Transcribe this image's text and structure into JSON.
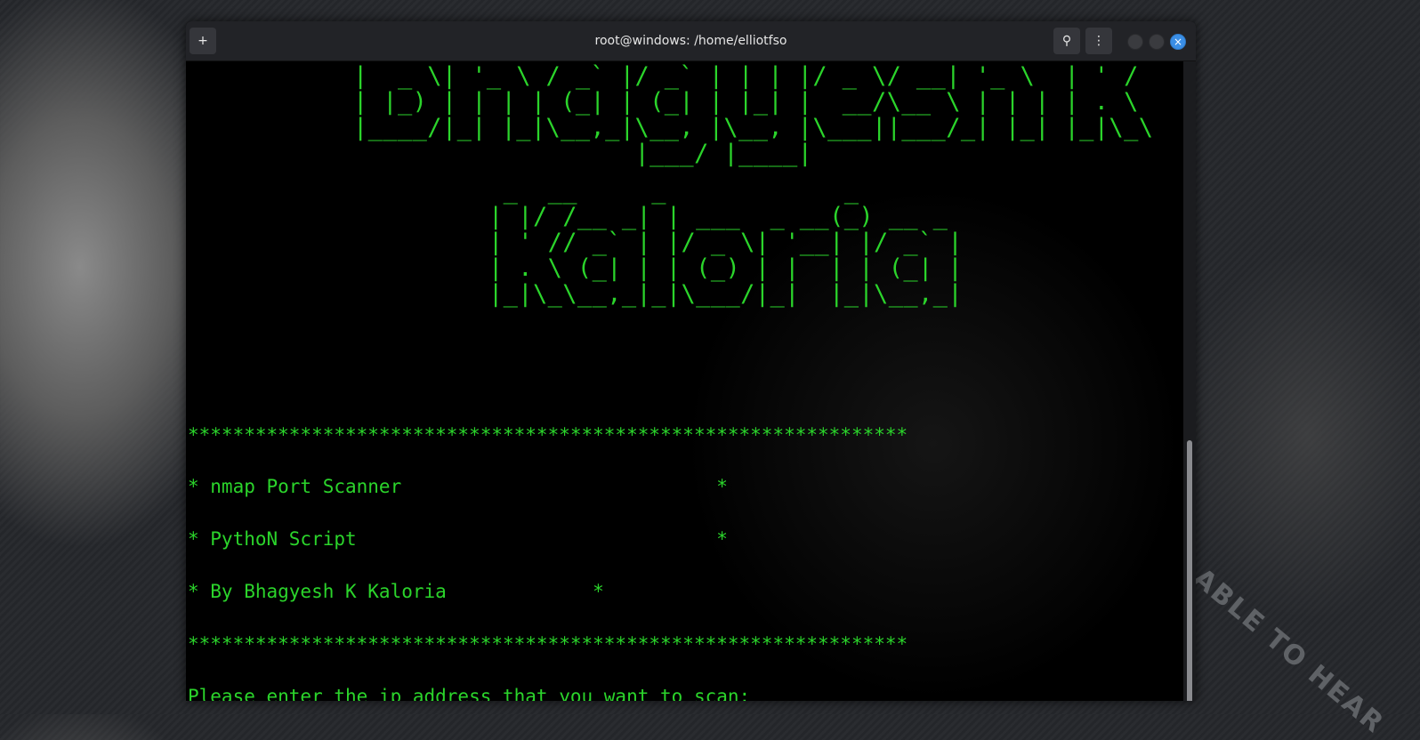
{
  "window": {
    "title": "root@windows: /home/elliotfso",
    "buttons": {
      "new_tab": "+",
      "search": "⚲",
      "menu": "⋮",
      "close": "×"
    }
  },
  "wallpaper": {
    "text": "E ABLE TO HEAR"
  },
  "terminal": {
    "banner_top": "|  _ \\| '_ \\ / _` |/ _` | | | |/ _ \\/ __| '_ \\  | ' /\n| |_) | | | | (_| | (_| | |_| |  __/\\__ \\ | | | | . \\\n|____/|_| |_|\\__,_|\\__, |\\__, |\\___||___/_| |_| |_|\\_\\\n                   |___/ |____|",
    "banner_bottom": " _  __     _            _\n| |/ /__ _| | ___  _ __(_) __ _\n| ' // _` | |/ _ \\| '__| |/ _` |\n| . \\ (_| | | (_) | |  | | (_| |\n|_|\\_\\__,_|_|\\___/|_|  |_|\\__,_|",
    "stars": "****************************************************************",
    "line1": "* nmap Port Scanner                            *",
    "line2": "* PythoN Script                                *",
    "line3": "* By Bhagyesh K Kaloria             *",
    "prompt": "Please enter the ip address that you want to scan: "
  }
}
